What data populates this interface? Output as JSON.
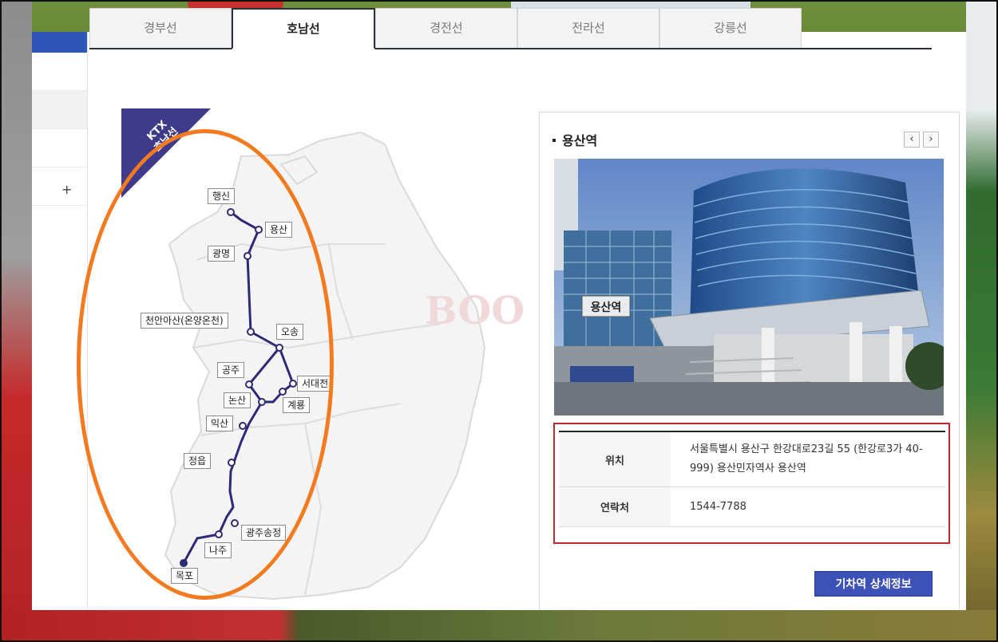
{
  "tabs": [
    {
      "label": "경부선",
      "active": false
    },
    {
      "label": "호남선",
      "active": true
    },
    {
      "label": "경전선",
      "active": false
    },
    {
      "label": "전라선",
      "active": false
    },
    {
      "label": "강릉선",
      "active": false
    }
  ],
  "left_nav": {
    "expand_icon": "+"
  },
  "map": {
    "badge": {
      "line1": "KTX",
      "line2": "호남선"
    },
    "watermark": "BOO",
    "line_color": "#2d2b78",
    "stations": [
      {
        "key": "haengsin",
        "name": "행신"
      },
      {
        "key": "yongsan",
        "name": "용산"
      },
      {
        "key": "gwangmyeong",
        "name": "광명"
      },
      {
        "key": "cheonan",
        "name": "천안아산(온양온천)"
      },
      {
        "key": "osong",
        "name": "오송"
      },
      {
        "key": "gongju",
        "name": "공주"
      },
      {
        "key": "seodaejeon",
        "name": "서대전"
      },
      {
        "key": "nonsan",
        "name": "논산"
      },
      {
        "key": "gyeryong",
        "name": "계룡"
      },
      {
        "key": "iksan",
        "name": "익산"
      },
      {
        "key": "jeongeup",
        "name": "정읍"
      },
      {
        "key": "gwangjusongjeong",
        "name": "광주송정"
      },
      {
        "key": "naju",
        "name": "나주"
      },
      {
        "key": "mokpo",
        "name": "목포"
      }
    ]
  },
  "station_panel": {
    "title": "용산역",
    "prev_icon": "‹",
    "next_icon": "›",
    "photo_sign": "용산역",
    "info": [
      {
        "label": "위치",
        "value": "서울특별시 용산구 한강대로23길 55 (한강로3가 40-999) 용산민자역사 용산역"
      },
      {
        "label": "연락처",
        "value": "1544-7788"
      }
    ],
    "detail_button": "기차역 상세정보"
  },
  "annotation_color": "#f47a20",
  "accent": "#2c57b8",
  "highlight_box_color": "#c0272d"
}
